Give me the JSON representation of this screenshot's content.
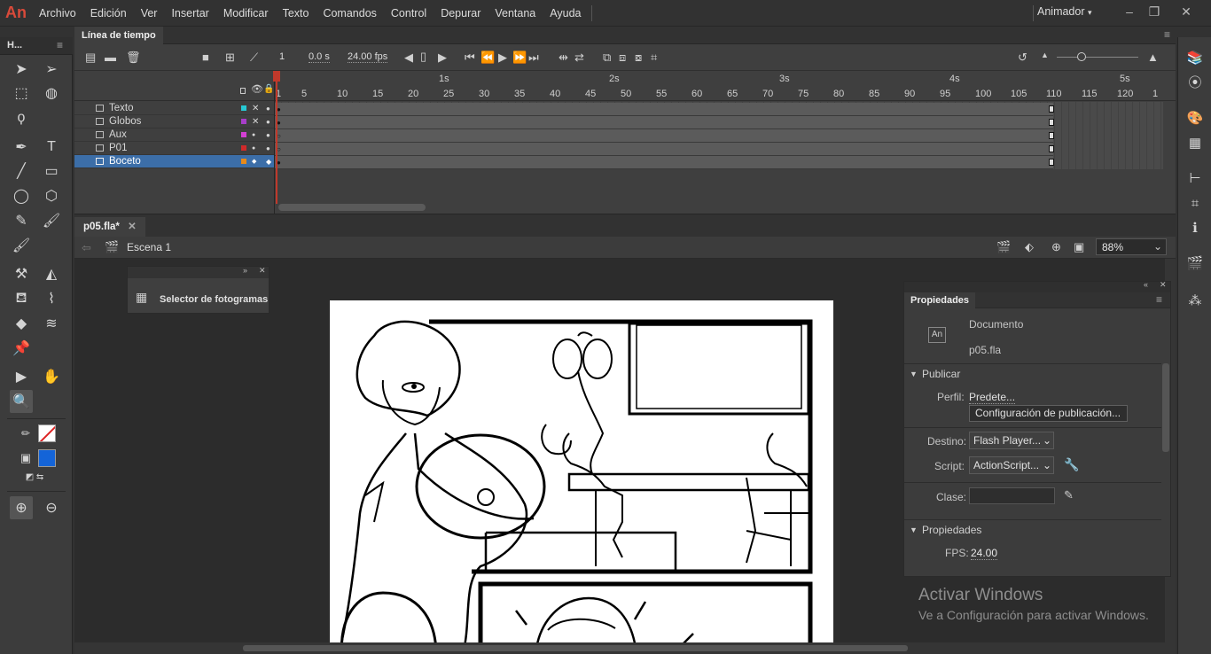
{
  "app": {
    "logo": "An",
    "workspace": "Animador",
    "window_controls": [
      "minimize-icon",
      "restore-icon",
      "close-icon"
    ]
  },
  "menu": [
    "Archivo",
    "Edición",
    "Ver",
    "Insertar",
    "Modificar",
    "Texto",
    "Comandos",
    "Control",
    "Depurar",
    "Ventana",
    "Ayuda"
  ],
  "toolbar": {
    "header": "H..."
  },
  "timeline": {
    "tab": "Línea de tiempo",
    "current_frame": "1",
    "time": "0.0 s",
    "fps": "24.00 fps",
    "seconds": [
      "1s",
      "2s",
      "3s",
      "4s",
      "5s"
    ],
    "frame_numbers": [
      "1",
      "5",
      "10",
      "15",
      "20",
      "25",
      "30",
      "35",
      "40",
      "45",
      "50",
      "55",
      "60",
      "65",
      "70",
      "75",
      "80",
      "85",
      "90",
      "95",
      "100",
      "105",
      "110",
      "115",
      "120",
      "1"
    ],
    "layers": [
      {
        "name": "Texto",
        "color": "#27c9d4",
        "hidden": true,
        "selected": false
      },
      {
        "name": "Globos",
        "color": "#a83ec9",
        "hidden": true,
        "selected": false
      },
      {
        "name": "Aux",
        "color": "#d43fd4",
        "hidden": false,
        "selected": false
      },
      {
        "name": "P01",
        "color": "#d02a2a",
        "hidden": false,
        "selected": false
      },
      {
        "name": "Boceto",
        "color": "#e88a1a",
        "hidden": false,
        "selected": true
      }
    ]
  },
  "document": {
    "tab": "p05.fla*",
    "scene": "Escena 1",
    "zoom": "88%"
  },
  "frame_picker": {
    "label": "Selector de fotogramas"
  },
  "properties": {
    "tab": "Propiedades",
    "doc_type": "Documento",
    "doc_icon": "An",
    "doc_name": "p05.fla",
    "publish_section": "Publicar",
    "profile_label": "Perfil:",
    "profile_value": "Predete...",
    "publish_settings_button": "Configuración de publicación...",
    "target_label": "Destino:",
    "target_value": "Flash Player...",
    "script_label": "Script:",
    "script_value": "ActionScript...",
    "class_label": "Clase:",
    "class_value": "",
    "props_section": "Propiedades",
    "fps_label": "FPS:",
    "fps_value": "24.00"
  },
  "watermark": {
    "line1": "Activar Windows",
    "line2": "Ve a Configuración para activar Windows."
  }
}
